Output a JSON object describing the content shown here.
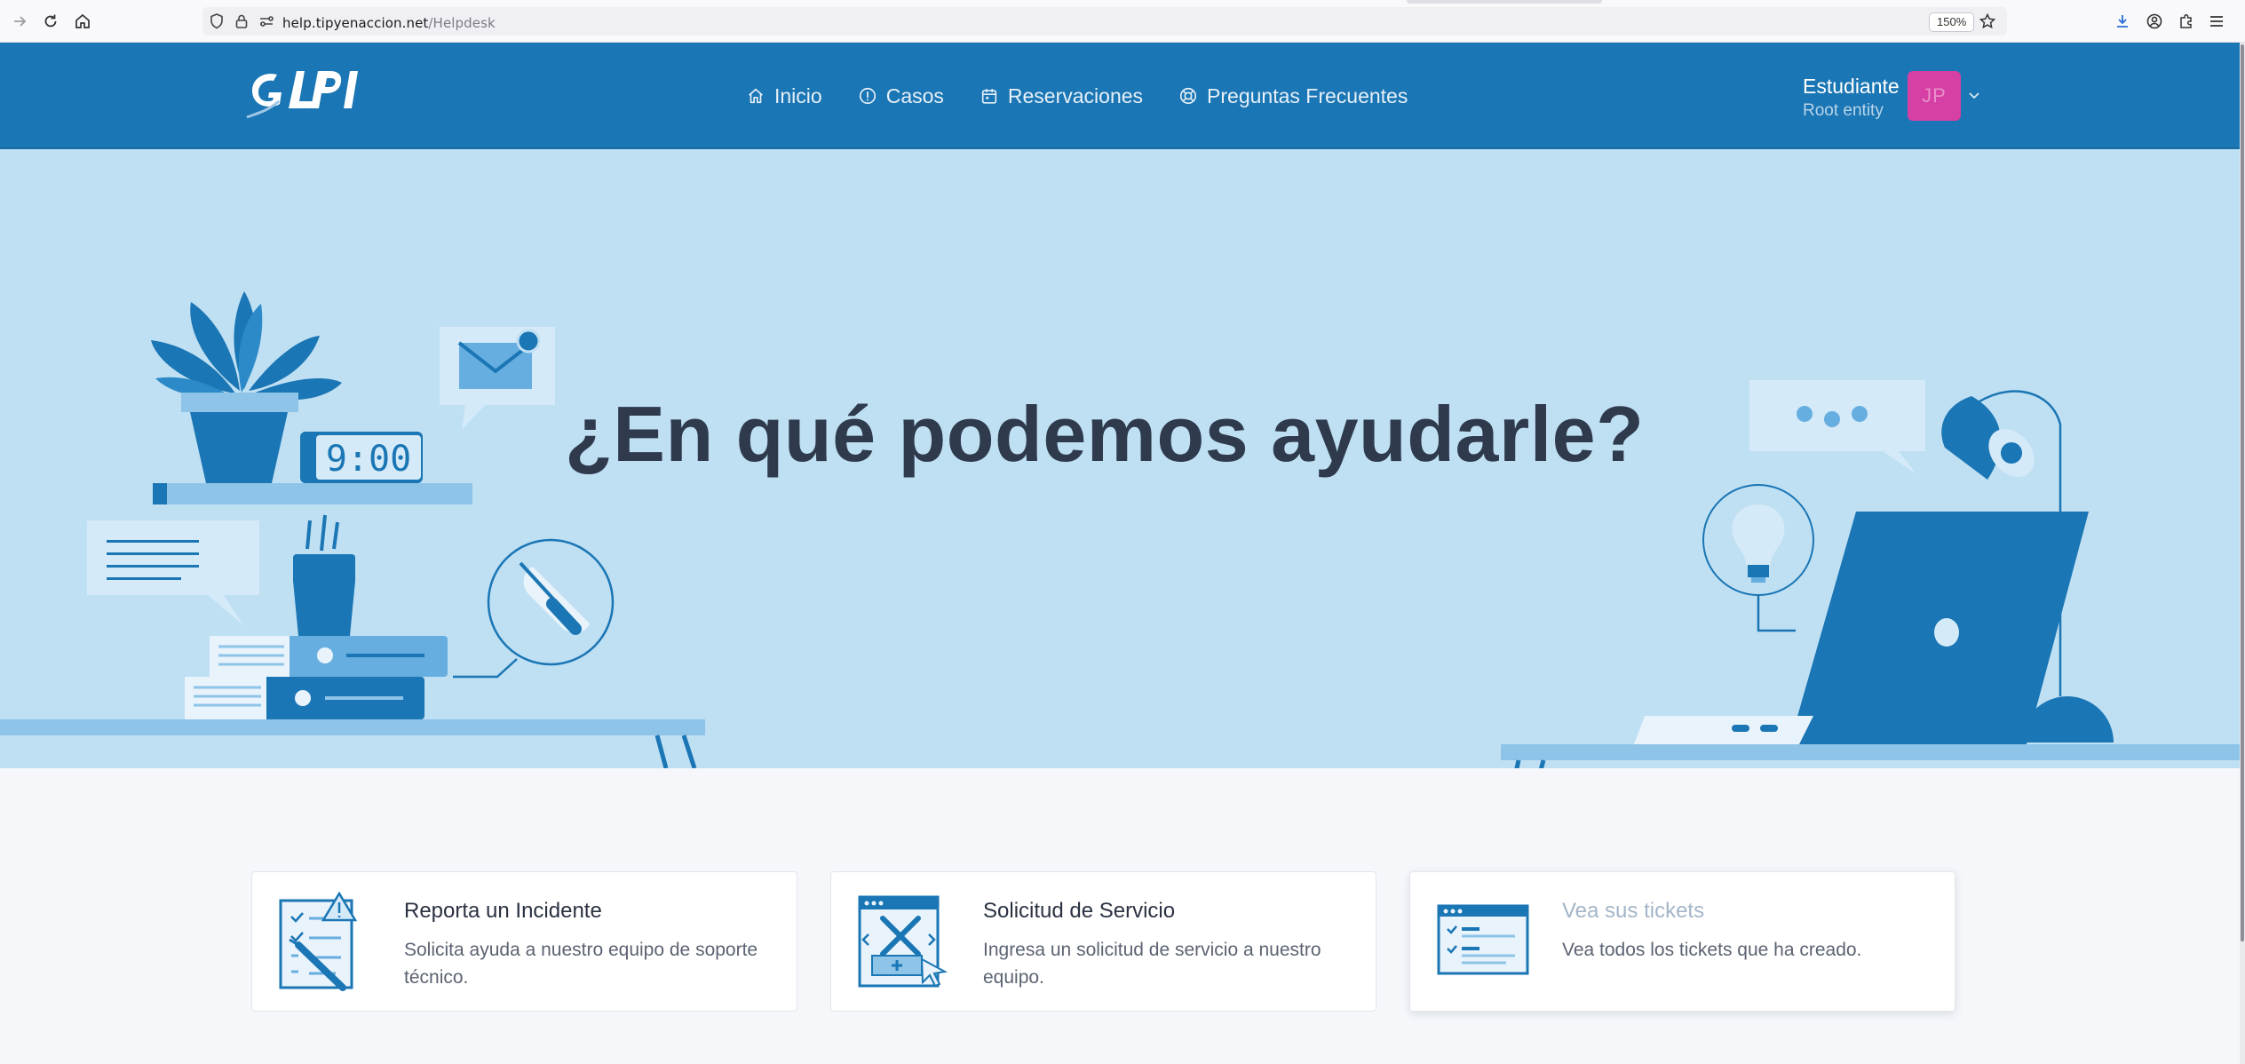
{
  "browser": {
    "url_host": "help.tipyenaccion.net",
    "url_path": "/Helpdesk",
    "zoom": "150%"
  },
  "header": {
    "nav": [
      {
        "label": "Inicio",
        "icon": "home-icon"
      },
      {
        "label": "Casos",
        "icon": "alert-circle-icon"
      },
      {
        "label": "Reservaciones",
        "icon": "calendar-icon"
      },
      {
        "label": "Preguntas Frecuentes",
        "icon": "lifebuoy-icon"
      }
    ],
    "user": {
      "name": "Estudiante",
      "entity": "Root entity",
      "initials": "JP"
    }
  },
  "hero": {
    "title": "¿En qué podemos ayudarle?",
    "clock": "9:00"
  },
  "cards": [
    {
      "title": "Reporta un Incidente",
      "description": "Solicita ayuda a nuestro equipo de soporte técnico.",
      "icon": "incident-checklist-icon"
    },
    {
      "title": "Solicitud de Servicio",
      "description": "Ingresa un solicitud de servicio a nuestro equipo.",
      "icon": "service-request-icon"
    },
    {
      "title": "Vea sus tickets",
      "description": "Vea todos los tickets que ha creado.",
      "icon": "tickets-list-icon"
    }
  ],
  "colors": {
    "brand": "#1a76b4",
    "hero_bg": "#bfdff3",
    "avatar": "#d63fa4",
    "title_text": "#2f3a4d"
  }
}
